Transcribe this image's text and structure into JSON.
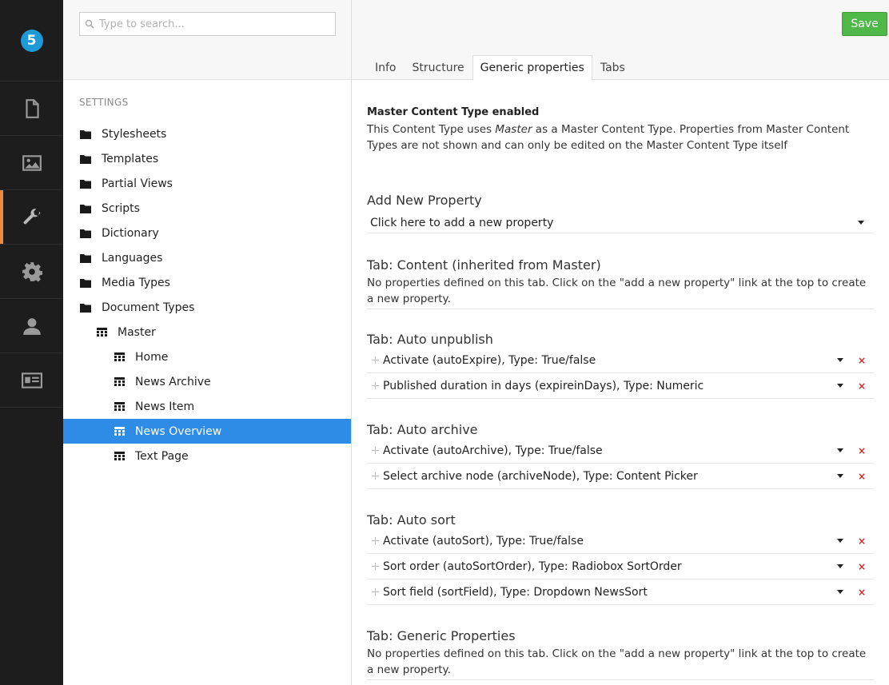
{
  "nav": {
    "logo_text": "5",
    "items": [
      {
        "name": "content",
        "icon": "document-icon"
      },
      {
        "name": "media",
        "icon": "image-icon"
      },
      {
        "name": "settings",
        "icon": "wrench-icon",
        "active": true
      },
      {
        "name": "developer",
        "icon": "gear-icon"
      },
      {
        "name": "users",
        "icon": "user-icon"
      },
      {
        "name": "members",
        "icon": "id-card-icon"
      }
    ]
  },
  "tree": {
    "search_placeholder": "Type to search...",
    "section_title": "SETTINGS",
    "items": [
      {
        "label": "Stylesheets",
        "icon": "folder-icon"
      },
      {
        "label": "Templates",
        "icon": "folder-icon"
      },
      {
        "label": "Partial Views",
        "icon": "folder-icon"
      },
      {
        "label": "Scripts",
        "icon": "folder-icon"
      },
      {
        "label": "Dictionary",
        "icon": "folder-icon"
      },
      {
        "label": "Languages",
        "icon": "folder-icon"
      },
      {
        "label": "Media Types",
        "icon": "folder-icon"
      },
      {
        "label": "Document Types",
        "icon": "folder-icon"
      },
      {
        "label": "Master",
        "icon": "doctype-icon"
      },
      {
        "label": "Home",
        "icon": "doctype-icon"
      },
      {
        "label": "News Archive",
        "icon": "doctype-icon"
      },
      {
        "label": "News Item",
        "icon": "doctype-icon"
      },
      {
        "label": "News Overview",
        "icon": "doctype-icon",
        "selected": true
      },
      {
        "label": "Text Page",
        "icon": "doctype-icon"
      }
    ]
  },
  "editor": {
    "save_label": "Save",
    "tabs": [
      "Info",
      "Structure",
      "Generic properties",
      "Tabs"
    ],
    "active_tab": "Generic properties",
    "notice": {
      "title": "Master Content Type enabled",
      "text_before": "This Content Type uses ",
      "text_em": "Master",
      "text_after": " as a Master Content Type. Properties from Master Content Types are not shown and can only be edited on the Master Content Type itself"
    },
    "add_property": {
      "title": "Add New Property",
      "select_value": "Click here to add a new property"
    },
    "empty_text": "No properties defined on this tab. Click on the \"add a new property\" link at the top to create a new property.",
    "groups": [
      {
        "title": "Tab: Content (inherited from Master)",
        "properties": []
      },
      {
        "title": "Tab: Auto unpublish",
        "properties": [
          "Activate (autoExpire), Type: True/false",
          "Published duration in days (expireinDays), Type: Numeric"
        ]
      },
      {
        "title": "Tab: Auto archive",
        "properties": [
          "Activate (autoArchive), Type: True/false",
          "Select archive node (archiveNode), Type: Content Picker"
        ]
      },
      {
        "title": "Tab: Auto sort",
        "properties": [
          "Activate (autoSort), Type: True/false",
          "Sort order (autoSortOrder), Type: Radiobox SortOrder",
          "Sort field (sortField), Type: Dropdown NewsSort"
        ]
      },
      {
        "title": "Tab: Generic Properties",
        "properties": []
      }
    ],
    "delete_glyph": "×",
    "colors": {
      "accent": "#2e8be6",
      "save": "#50b848",
      "active_nav": "#e98c42",
      "delete": "#c62b2b"
    }
  }
}
